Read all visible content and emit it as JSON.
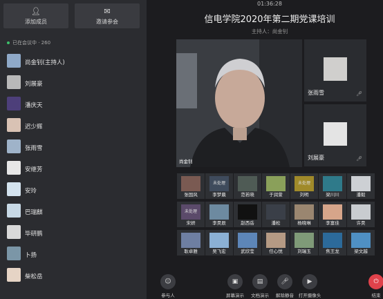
{
  "sidebar": {
    "add_member": "添加成员",
    "invite": "邀请参会",
    "in_meeting": "已在会议中 · 260",
    "participants": [
      {
        "name": "尚金钊(主持人)",
        "color": "#8fa9c8"
      },
      {
        "name": "刘展豪",
        "color": "#b9b9b9"
      },
      {
        "name": "潘庆天",
        "color": "#4d3f7a"
      },
      {
        "name": "迟少辉",
        "color": "#d9c2b4"
      },
      {
        "name": "张雨雪",
        "color": "#9fb3c9"
      },
      {
        "name": "安继芳",
        "color": "#e7e7e7"
      },
      {
        "name": "安玲",
        "color": "#d4e3ef"
      },
      {
        "name": "巴瑞麒",
        "color": "#c8d9e6"
      },
      {
        "name": "毕研鹏",
        "color": "#d9d9d9"
      },
      {
        "name": "卜扬",
        "color": "#7b96a7"
      },
      {
        "name": "柴松岳",
        "color": "#e6d4c5"
      }
    ]
  },
  "meeting": {
    "timer": "01:36:28",
    "title": "信电学院2020年第二期党课培训",
    "host_line": "主持人：尚金钊",
    "main_speaker": "尚金钊",
    "side_videos": [
      {
        "name": "张雨雪",
        "color": "#d0cfcd"
      },
      {
        "name": "刘展豪",
        "color": "#e4e4e4"
      }
    ]
  },
  "grid": [
    {
      "name": "张国风",
      "sub": "",
      "color": "#7a5a52"
    },
    {
      "name": "李梦晨",
      "sub": "未处理",
      "color": "#3f4b5c"
    },
    {
      "name": "范若晓",
      "sub": "",
      "color": "#4f5b55"
    },
    {
      "name": "于润萱",
      "sub": "",
      "color": "#8aa05a"
    },
    {
      "name": "刘明",
      "sub": "未处理",
      "color": "#a08a2a"
    },
    {
      "name": "梁川川",
      "sub": "",
      "color": "#2f7a8a"
    },
    {
      "name": "潘毅",
      "sub": "",
      "color": "#cdd0d4"
    },
    {
      "name": "宋妍",
      "sub": "未处理",
      "color": "#5b4a6a"
    },
    {
      "name": "李昊辰",
      "sub": "",
      "color": "#6d8aa0"
    },
    {
      "name": "赵西岳",
      "sub": "",
      "color": "#111111"
    },
    {
      "name": "潘松",
      "sub": "",
      "color": "#3a3f48"
    },
    {
      "name": "杨晓琳",
      "sub": "",
      "color": "#9a8670"
    },
    {
      "name": "李富佳",
      "sub": "",
      "color": "#d6a58a"
    },
    {
      "name": "许昊",
      "sub": "",
      "color": "#c9ccd0"
    },
    {
      "name": "耿卓雅",
      "sub": "",
      "color": "#6e7fa2"
    },
    {
      "name": "吴飞宏",
      "sub": "",
      "color": "#8bb0d4"
    },
    {
      "name": "武欣莹",
      "sub": "",
      "color": "#5d86b8"
    },
    {
      "name": "任心悦",
      "sub": "",
      "color": "#b59a84"
    },
    {
      "name": "刘瑞玉",
      "sub": "",
      "color": "#7f9a78"
    },
    {
      "name": "焦王龙",
      "sub": "",
      "color": "#2c6a9a"
    },
    {
      "name": "梁文越",
      "sub": "",
      "color": "#4f90c4"
    }
  ],
  "toolbar": {
    "participants": "参与人",
    "screen_share": "屏幕演示",
    "doc_share": "文档演示",
    "unmute": "解除静音",
    "camera": "打开摄像头",
    "end": "结束"
  },
  "colors": {
    "end": "#e0424b",
    "online": "#3cc06a"
  }
}
